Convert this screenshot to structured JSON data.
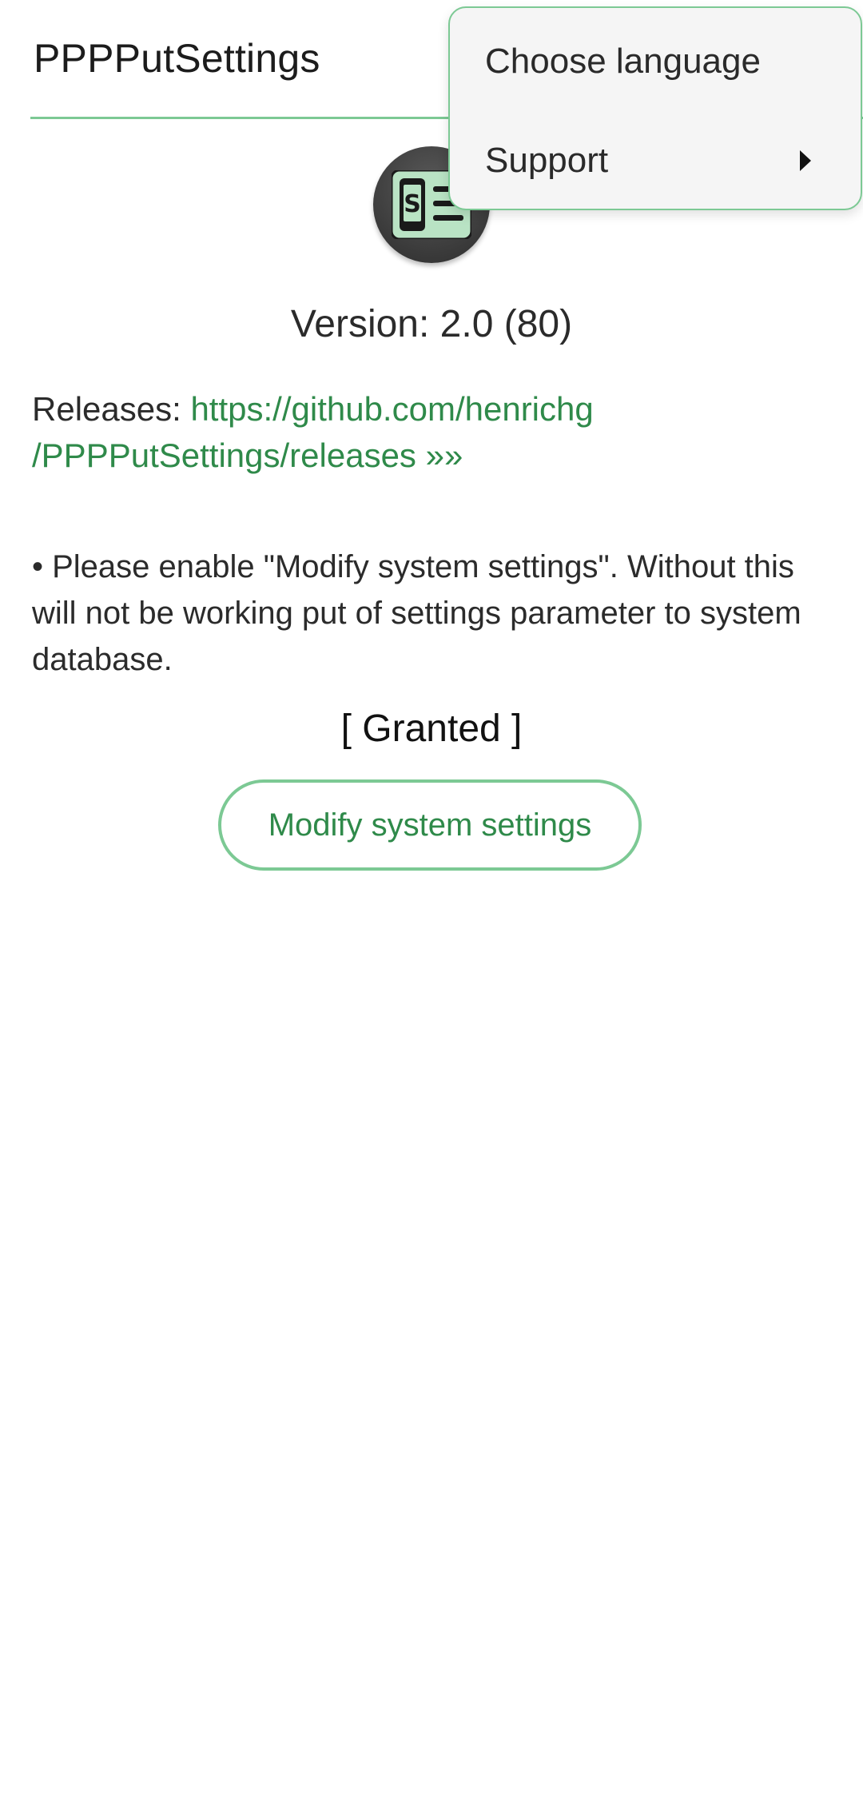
{
  "toolbar": {
    "title": "PPPPutSettings"
  },
  "menu": {
    "items": [
      {
        "label": "Choose language",
        "has_submenu": false
      },
      {
        "label": "Support",
        "has_submenu": true
      }
    ]
  },
  "about": {
    "icon": "app-icon-phone-settings",
    "version": "Version: 2.0 (80)",
    "releases_label": "Releases: ",
    "releases_link": "https://github.com/henrichg /PPPPutSettings/releases »»",
    "description": "• Please enable \"Modify system settings\". Without this will not be working put of settings parameter to system database.",
    "status": "[ Granted ]",
    "modify_button_label": "Modify system settings"
  },
  "colors": {
    "accent": "#2f8a4a",
    "accent_light": "#7cc994",
    "background": "#ffffff",
    "menu_background": "#f5f5f5"
  }
}
